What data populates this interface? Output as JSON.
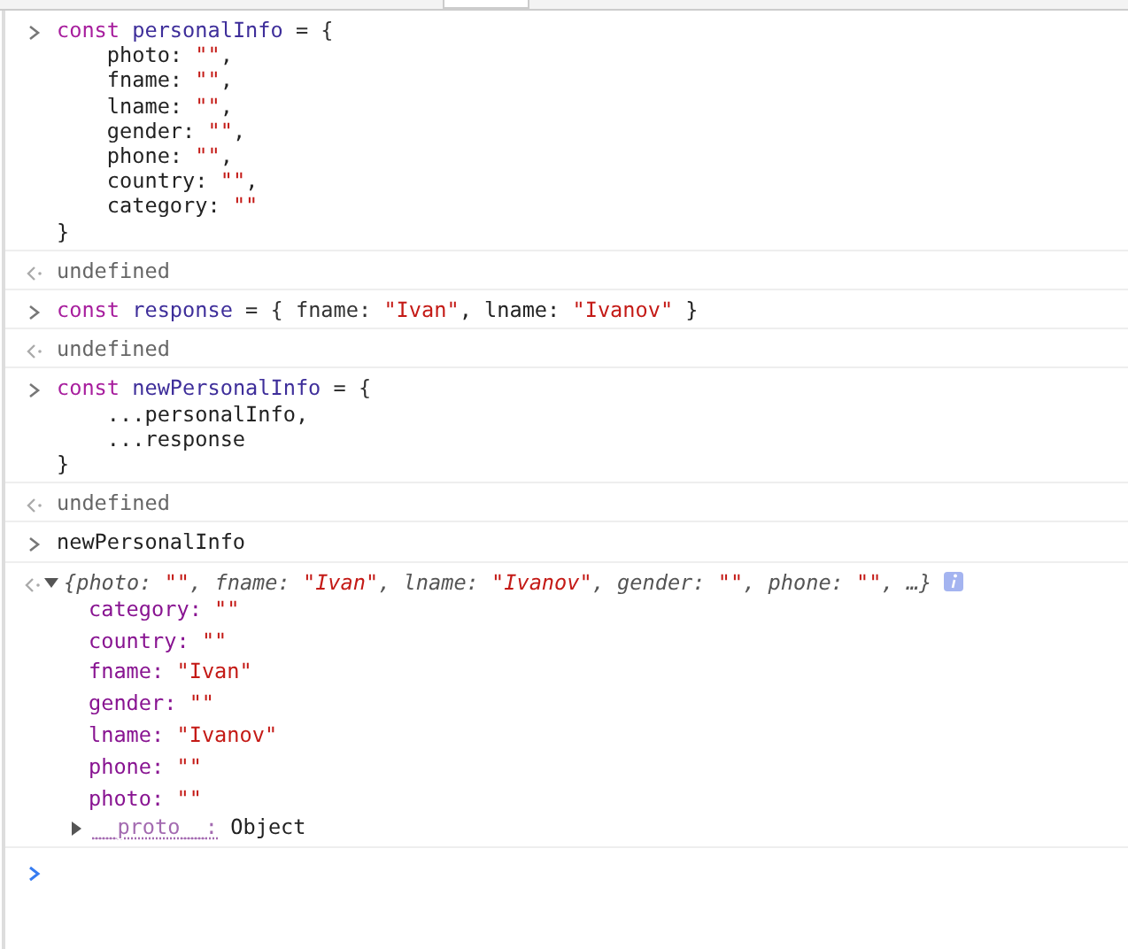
{
  "entries": [
    {
      "kind": "input",
      "lines": [
        [
          {
            "t": "const ",
            "kind": "kw"
          },
          {
            "t": "personalInfo",
            "kind": "def"
          },
          {
            "t": " = {",
            "kind": "op"
          }
        ],
        [
          {
            "t": "    photo: ",
            "kind": "plain"
          },
          {
            "t": "\"\"",
            "kind": "str"
          },
          {
            "t": ",",
            "kind": "plain"
          }
        ],
        [
          {
            "t": "    fname: ",
            "kind": "plain"
          },
          {
            "t": "\"\"",
            "kind": "str"
          },
          {
            "t": ",",
            "kind": "plain"
          }
        ],
        [
          {
            "t": "    lname: ",
            "kind": "plain"
          },
          {
            "t": "\"\"",
            "kind": "str"
          },
          {
            "t": ",",
            "kind": "plain"
          }
        ],
        [
          {
            "t": "    gender: ",
            "kind": "plain"
          },
          {
            "t": "\"\"",
            "kind": "str"
          },
          {
            "t": ",",
            "kind": "plain"
          }
        ],
        [
          {
            "t": "    phone: ",
            "kind": "plain"
          },
          {
            "t": "\"\"",
            "kind": "str"
          },
          {
            "t": ",",
            "kind": "plain"
          }
        ],
        [
          {
            "t": "    country: ",
            "kind": "plain"
          },
          {
            "t": "\"\"",
            "kind": "str"
          },
          {
            "t": ",",
            "kind": "plain"
          }
        ],
        [
          {
            "t": "    category: ",
            "kind": "plain"
          },
          {
            "t": "\"\"",
            "kind": "str"
          }
        ],
        [
          {
            "t": "}",
            "kind": "plain"
          }
        ]
      ]
    },
    {
      "kind": "result",
      "text": "undefined"
    },
    {
      "kind": "input",
      "lines": [
        [
          {
            "t": "const ",
            "kind": "kw"
          },
          {
            "t": "response",
            "kind": "def"
          },
          {
            "t": " = { fname: ",
            "kind": "op"
          },
          {
            "t": "\"Ivan\"",
            "kind": "str"
          },
          {
            "t": ", lname: ",
            "kind": "plain"
          },
          {
            "t": "\"Ivanov\"",
            "kind": "str"
          },
          {
            "t": " }",
            "kind": "plain"
          }
        ]
      ]
    },
    {
      "kind": "result",
      "text": "undefined"
    },
    {
      "kind": "input",
      "lines": [
        [
          {
            "t": "const ",
            "kind": "kw"
          },
          {
            "t": "newPersonalInfo",
            "kind": "def"
          },
          {
            "t": " = {",
            "kind": "op"
          }
        ],
        [
          {
            "t": "    ...personalInfo,",
            "kind": "plain"
          }
        ],
        [
          {
            "t": "    ...response",
            "kind": "plain"
          }
        ],
        [
          {
            "t": "}",
            "kind": "plain"
          }
        ]
      ]
    },
    {
      "kind": "result",
      "text": "undefined"
    },
    {
      "kind": "input",
      "lines": [
        [
          {
            "t": "newPersonalInfo",
            "kind": "plain"
          }
        ]
      ]
    },
    {
      "kind": "object",
      "expanded": true,
      "summary": [
        {
          "t": "{photo: ",
          "kind": "plain"
        },
        {
          "t": "\"\"",
          "kind": "str"
        },
        {
          "t": ", fname: ",
          "kind": "plain"
        },
        {
          "t": "\"Ivan\"",
          "kind": "str"
        },
        {
          "t": ", lname: ",
          "kind": "plain"
        },
        {
          "t": "\"Ivanov\"",
          "kind": "str"
        },
        {
          "t": ", gender: ",
          "kind": "plain"
        },
        {
          "t": "\"\"",
          "kind": "str"
        },
        {
          "t": ", phone: ",
          "kind": "plain"
        },
        {
          "t": "\"\"",
          "kind": "str"
        },
        {
          "t": ", …}",
          "kind": "plain"
        }
      ],
      "properties": [
        {
          "key": "category:",
          "value": "\"\""
        },
        {
          "key": "country:",
          "value": "\"\""
        },
        {
          "key": "fname:",
          "value": "\"Ivan\""
        },
        {
          "key": "gender:",
          "value": "\"\""
        },
        {
          "key": "lname:",
          "value": "\"Ivanov\""
        },
        {
          "key": "phone:",
          "value": "\"\""
        },
        {
          "key": "photo:",
          "value": "\"\""
        }
      ],
      "proto": {
        "key": "__proto__:",
        "value": "Object",
        "expanded": false
      }
    },
    {
      "kind": "prompt"
    }
  ]
}
